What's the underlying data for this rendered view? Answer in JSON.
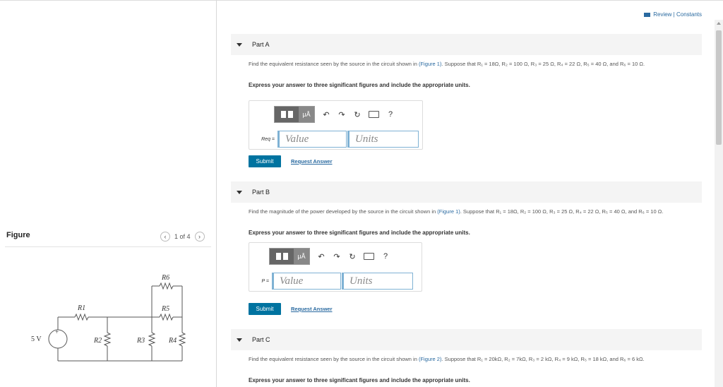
{
  "header": {
    "review_link": "Review | Constants"
  },
  "figure": {
    "label": "Figure",
    "pager_text": "1 of 4",
    "prev_icon": "chevron-left-icon",
    "next_icon": "chevron-right-icon",
    "source_label": "5 V",
    "plus_sign": "+",
    "resistors": [
      "R1",
      "R2",
      "R3",
      "R4",
      "R5",
      "R6"
    ]
  },
  "toolbar": {
    "mu_label": "μÅ",
    "help_label": "?",
    "icons": [
      "templates-icon",
      "mu-units-icon",
      "undo-icon",
      "redo-icon",
      "reset-icon",
      "keyboard-icon",
      "help-icon"
    ]
  },
  "parts": [
    {
      "title": "Part A",
      "question": "Find the equivalent resistance seen by the source in the circuit shown in (Figure 1). Suppose that R₁ = 18Ω, R₂ = 100 Ω, R₃ = 25 Ω, R₄ = 22 Ω, R₅ = 40 Ω, and R₆ = 10 Ω.",
      "instruction": "Express your answer to three significant figures and include the appropriate units.",
      "field_label": "Req =",
      "value_placeholder": "Value",
      "units_placeholder": "Units",
      "submit_label": "Submit",
      "request_label": "Request Answer"
    },
    {
      "title": "Part B",
      "question": "Find the magnitude of the power developed by the source in the circuit shown in (Figure 1). Suppose that R₁ = 18Ω, R₂ = 100 Ω, R₃ = 25 Ω, R₄ = 22 Ω, R₅ = 40 Ω, and R₆ = 10 Ω.",
      "instruction": "Express your answer to three significant figures and include the appropriate units.",
      "field_label": "P =",
      "value_placeholder": "Value",
      "units_placeholder": "Units",
      "submit_label": "Submit",
      "request_label": "Request Answer"
    },
    {
      "title": "Part C",
      "question": "Find the equivalent resistance seen by the source in the circuit shown in (Figure 2). Suppose that R₁ = 20kΩ, R₂ = 7kΩ, R₃ = 2 kΩ, R₄ = 9 kΩ, R₅ = 18 kΩ, and R₆ = 6 kΩ.",
      "instruction": "Express your answer to three significant figures and include the appropriate units."
    }
  ],
  "colors": {
    "accent": "#0073a0",
    "link": "#2a6aa0",
    "input_border": "#7fb2d4"
  }
}
